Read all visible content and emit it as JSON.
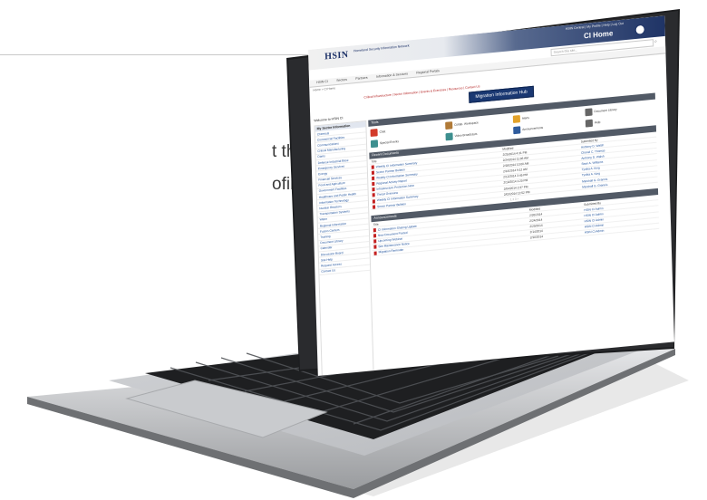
{
  "background_text": {
    "line1": "t through",
    "line2": "ofing"
  },
  "screen": {
    "header": {
      "logo": "HSIN",
      "logo_sub": "Homeland Security Information Network",
      "login_links": "HSIN Central  |  My Profile  |  Help  |  Log Out",
      "site_title": "CI Home",
      "search_placeholder": "Search this site..."
    },
    "nav": [
      "HSIN CI",
      "Sectors",
      "Partners",
      "Information & Services",
      "Regional Portals"
    ],
    "breadcrumb": "Home > CI Home",
    "links_row": "Critical Infrastructure  |  Sector Information  |  Events & Exercises  |  Resources  |  Contact Us",
    "migration_button": "Migration Information Hub",
    "welcome": "Welcome to HSIN CI",
    "sidebar": {
      "header": "My Sector Information",
      "items": [
        "Chemical",
        "Commercial Facilities",
        "Communications",
        "Critical Manufacturing",
        "Dams",
        "Defense Industrial Base",
        "Emergency Services",
        "Energy",
        "Financial Services",
        "Food and Agriculture",
        "Government Facilities",
        "Healthcare and Public Health",
        "Information Technology",
        "Nuclear Reactors",
        "Transportation Systems",
        "Water",
        "Regional Information",
        "Fusion Centers",
        "Training",
        "Document Library",
        "Calendar",
        "Discussion Board",
        "Site Help",
        "Request Access",
        "Contact Us"
      ]
    },
    "tools_bar": "Tools",
    "tools": [
      "Chat",
      "Collab. Workspace",
      "Alerts",
      "Document Library",
      "Special Events",
      "Video Broadcasts",
      "Announcements",
      "Help"
    ],
    "docs_bar": "Recent Documents",
    "docs_columns": [
      "Title",
      "Modified",
      "Submitted By"
    ],
    "docs": [
      {
        "title": "Weekly CI Information Summary",
        "date": "2/25/2014 4:31 PM",
        "by": "Anthony D. Walsh"
      },
      {
        "title": "Sector Partner Bulletin",
        "date": "2/24/2014 11:06 AM",
        "by": "Chanel C. Thomas"
      },
      {
        "title": "Weekly CI Information Summary",
        "date": "2/18/2014 10:00 AM",
        "by": "Anthony D. Walsh"
      },
      {
        "title": "Regional Activity Report",
        "date": "2/14/2014 9:12 AM",
        "by": "Sean A. Williams"
      },
      {
        "title": "Infrastructure Protection Note",
        "date": "2/12/2014 3:45 PM",
        "by": "Tynika A. King"
      },
      {
        "title": "Threat Overview",
        "date": "2/10/2014 1:20 PM",
        "by": "Tynika A. King"
      },
      {
        "title": "Weekly CI Information Summary",
        "date": "2/04/2014 2:37 PM",
        "by": "Marshall G. Grannis"
      },
      {
        "title": "Sector Partner Bulletin",
        "date": "2/03/2014 12:52 PM",
        "by": "Marshall G. Grannis"
      }
    ],
    "pager": "1  2  3  >",
    "announce_bar": "Announcements",
    "announce_columns": [
      "Title",
      "Modified",
      "Submitted By"
    ],
    "announcements": [
      {
        "title": "CI Information Sharing Update",
        "date": "2/26/2014",
        "by": "HSIN CI Admin"
      },
      {
        "title": "New Document Posted",
        "date": "2/24/2014",
        "by": "HSIN CI Admin"
      },
      {
        "title": "Upcoming Webinar",
        "date": "2/20/2014",
        "by": "HSIN CI Admin"
      },
      {
        "title": "Site Maintenance Notice",
        "date": "2/14/2014",
        "by": "HSIN CI Admin"
      },
      {
        "title": "Migration Reminder",
        "date": "2/10/2014",
        "by": "HSIN CI Admin"
      }
    ]
  },
  "colors": {
    "header_dark": "#1f3466",
    "nav_bar": "#525a66",
    "link_red": "#b11b1b",
    "link_blue": "#1c4f9a"
  }
}
